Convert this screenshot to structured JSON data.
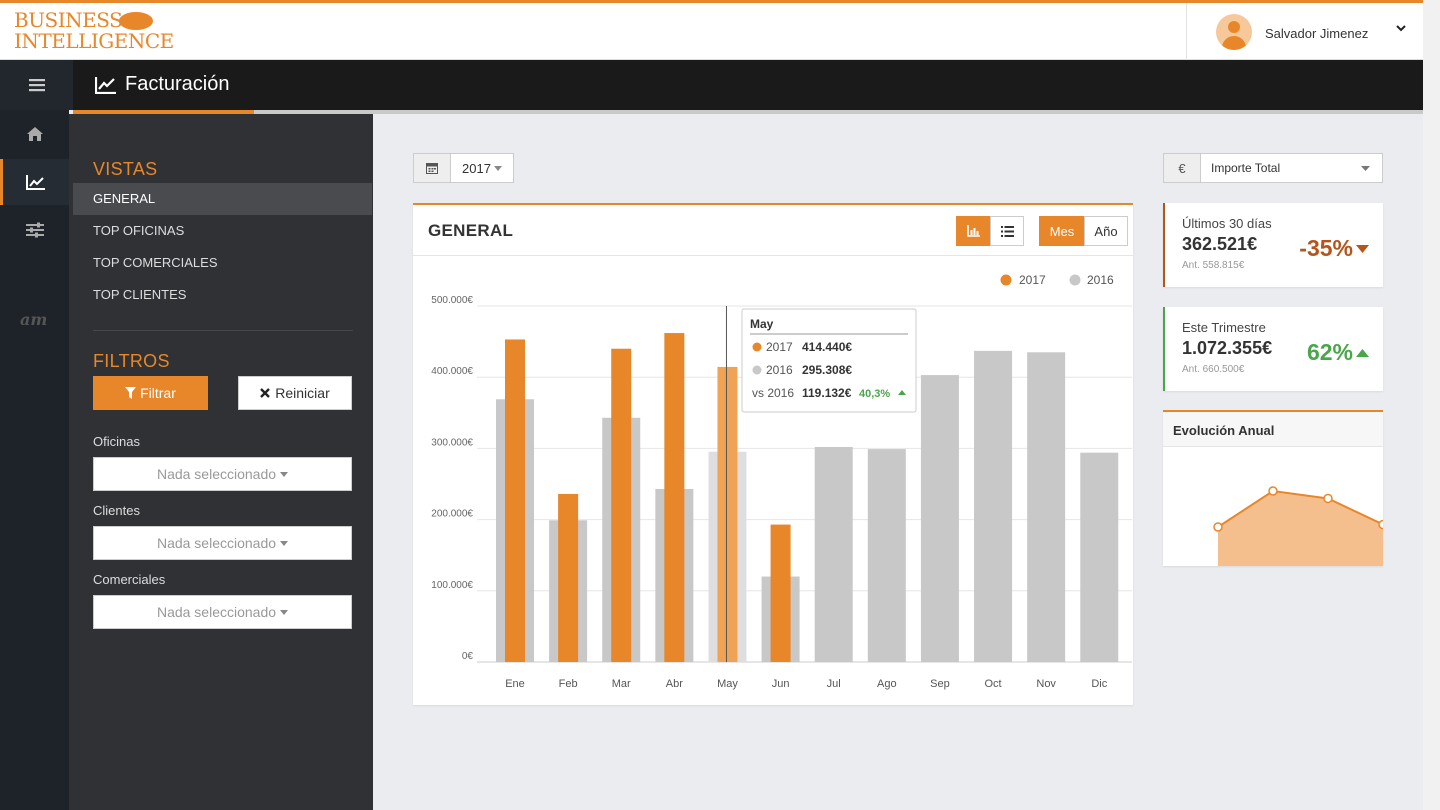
{
  "header": {
    "logo_line1": "BUSINESS",
    "logo_line2": "INTELLIGENCE",
    "user_name": "Salvador Jimenez"
  },
  "page": {
    "title": "Facturación"
  },
  "rail": {
    "items": [
      {
        "name": "home-icon",
        "active": false
      },
      {
        "name": "chart-line-icon",
        "active": true
      },
      {
        "name": "sliders-icon",
        "active": false
      }
    ],
    "bottom_logo": "am"
  },
  "sidebar": {
    "vistas_title": "VISTAS",
    "vistas": [
      "GENERAL",
      "TOP OFICINAS",
      "TOP COMERCIALES",
      "TOP CLIENTES"
    ],
    "active_vista": "GENERAL",
    "filtros_title": "FILTROS",
    "filter_button": "Filtrar",
    "reset_button": "Reiniciar",
    "fields": [
      {
        "label": "Oficinas",
        "value": "Nada seleccionado"
      },
      {
        "label": "Clientes",
        "value": "Nada seleccionado"
      },
      {
        "label": "Comerciales",
        "value": "Nada seleccionado"
      }
    ]
  },
  "year_picker": {
    "value": "2017"
  },
  "chart_card": {
    "title": "GENERAL",
    "period_buttons": [
      "Mes",
      "Año"
    ],
    "active_period": "Mes"
  },
  "chart_data": {
    "type": "bar",
    "categories": [
      "Ene",
      "Feb",
      "Mar",
      "Abr",
      "May",
      "Jun",
      "Jul",
      "Ago",
      "Sep",
      "Oct",
      "Nov",
      "Dic"
    ],
    "series": [
      {
        "name": "2017",
        "color": "#e8862a",
        "values": [
          453000,
          236000,
          440000,
          462000,
          414440,
          193000,
          null,
          null,
          null,
          null,
          null,
          null
        ]
      },
      {
        "name": "2016",
        "color": "#c8c8c8",
        "values": [
          369000,
          199000,
          343000,
          243000,
          295308,
          120000,
          302000,
          299000,
          403000,
          437000,
          435000,
          294000
        ]
      }
    ],
    "y_ticks": [
      "0€",
      "100.000€",
      "200.000€",
      "300.000€",
      "400.000€",
      "500.000€"
    ],
    "ylim": [
      0,
      500000
    ],
    "legend": "top-right",
    "tooltip": {
      "title": "May",
      "row1_label": "2017",
      "row1_value": "414.440€",
      "row2_label": "2016",
      "row2_value": "295.308€",
      "row3_label": "vs 2016",
      "row3_value": "119.132€",
      "row3_pct": "40,3%"
    }
  },
  "kpi_select": {
    "addon": "€",
    "value": "Importe Total"
  },
  "kpis": [
    {
      "label": "Últimos 30 días",
      "value": "362.521€",
      "previous": "Ant. 558.815€",
      "change": "-35%",
      "color": "#b5541b",
      "direction": "down"
    },
    {
      "label": "Este Trimestre",
      "value": "1.072.355€",
      "previous": "Ant. 660.500€",
      "change": "62%",
      "color": "#4aa64a",
      "direction": "up"
    }
  ],
  "evolucion": {
    "title": "Evolución Anual",
    "values": [
      0.42,
      1.0,
      0.88,
      0.46
    ]
  }
}
